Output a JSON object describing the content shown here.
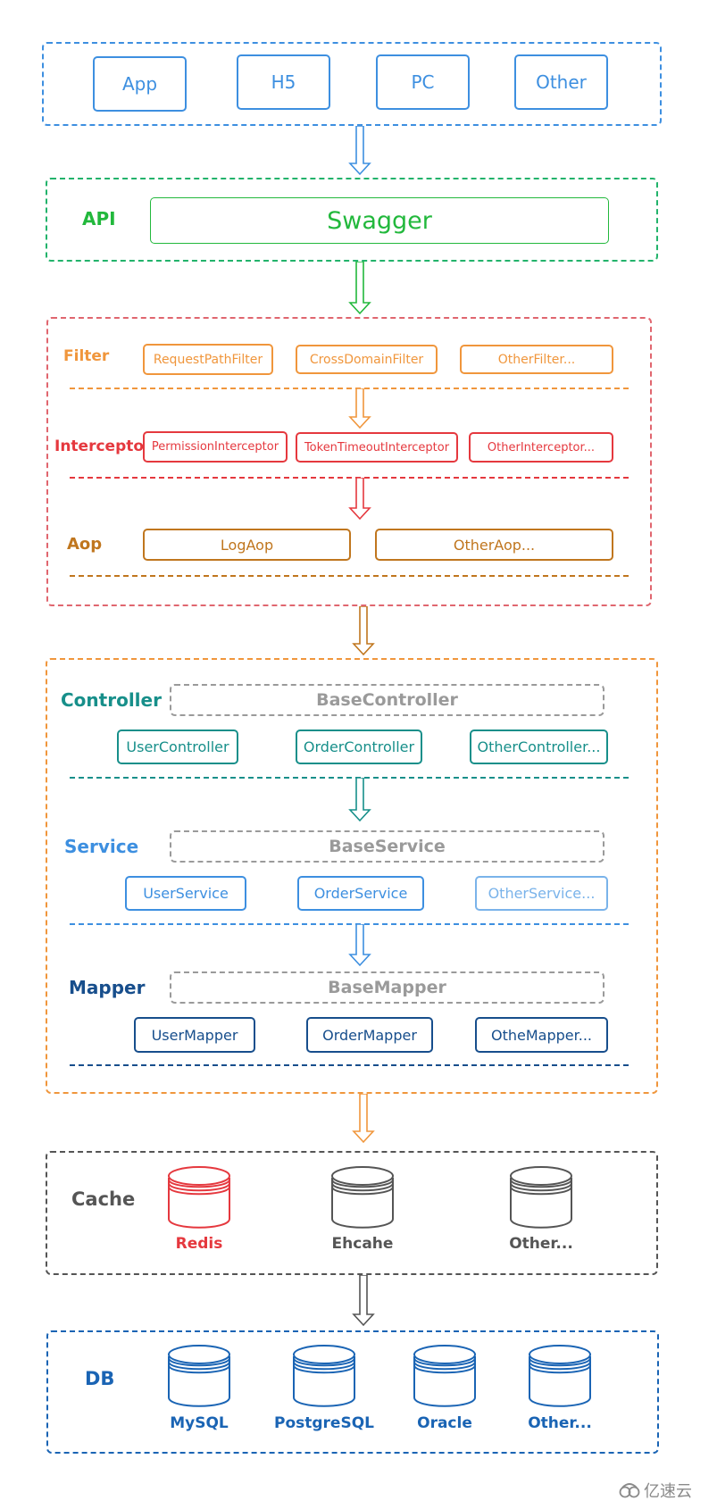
{
  "colors": {
    "client": "#3d8fe0",
    "api": "#22b83c",
    "api_group": "#22b36b",
    "aop_group": "#e0666f",
    "filter": "#f0963c",
    "interceptor": "#e5383e",
    "aop": "#c0761e",
    "controller": "#178f8a",
    "service": "#3d8fe0",
    "service_faded": "#7ab3ea",
    "mapper": "#174e8c",
    "core_group": "#f0963c",
    "base": "#9a9a9a",
    "cache_group": "#555555",
    "redis": "#e5383e",
    "cache_gray": "#555555",
    "db": "#1a64b4"
  },
  "clients": {
    "items": [
      {
        "label": "App"
      },
      {
        "label": "H5"
      },
      {
        "label": "PC"
      },
      {
        "label": "Other"
      }
    ]
  },
  "api": {
    "label": "API",
    "component": "Swagger"
  },
  "filter": {
    "label": "Filter",
    "items": [
      {
        "label": "RequestPathFilter"
      },
      {
        "label": "CrossDomainFilter"
      },
      {
        "label": "OtherFilter..."
      }
    ]
  },
  "interceptor": {
    "label": "Interceptor",
    "items": [
      {
        "label": "PermissionInterceptor"
      },
      {
        "label": "TokenTimeoutInterceptor"
      },
      {
        "label": "OtherInterceptor..."
      }
    ]
  },
  "aop": {
    "label": "Aop",
    "items": [
      {
        "label": "LogAop"
      },
      {
        "label": "OtherAop..."
      }
    ]
  },
  "controller": {
    "label": "Controller",
    "base": "BaseController",
    "items": [
      {
        "label": "UserController"
      },
      {
        "label": "OrderController"
      },
      {
        "label": "OtherController..."
      }
    ]
  },
  "service": {
    "label": "Service",
    "base": "BaseService",
    "items": [
      {
        "label": "UserService"
      },
      {
        "label": "OrderService"
      },
      {
        "label": "OtherService..."
      }
    ]
  },
  "mapper": {
    "label": "Mapper",
    "base": "BaseMapper",
    "items": [
      {
        "label": "UserMapper"
      },
      {
        "label": "OrderMapper"
      },
      {
        "label": "OtheMapper..."
      }
    ]
  },
  "cache": {
    "label": "Cache",
    "items": [
      {
        "label": "Redis",
        "icon": "database-icon"
      },
      {
        "label": "Ehcahe",
        "icon": "database-icon"
      },
      {
        "label": "Other...",
        "icon": "database-icon"
      }
    ]
  },
  "db": {
    "label": "DB",
    "items": [
      {
        "label": "MySQL",
        "icon": "database-icon"
      },
      {
        "label": "PostgreSQL",
        "icon": "database-icon"
      },
      {
        "label": "Oracle",
        "icon": "database-icon"
      },
      {
        "label": "Other...",
        "icon": "database-icon"
      }
    ]
  },
  "watermark": {
    "text": "亿速云",
    "icon": "cloud-logo-icon"
  }
}
